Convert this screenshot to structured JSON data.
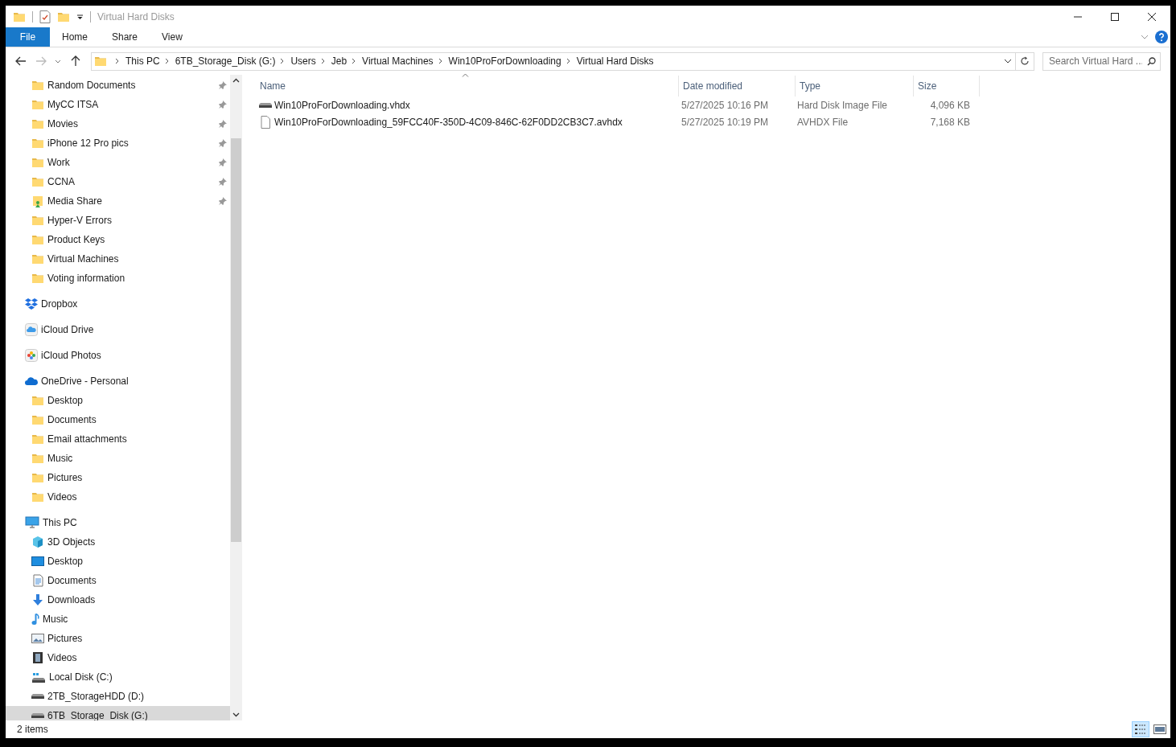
{
  "window": {
    "title": "Virtual Hard Disks"
  },
  "ribbon_tabs": [
    {
      "label": "File",
      "selected": true
    },
    {
      "label": "Home",
      "selected": false
    },
    {
      "label": "Share",
      "selected": false
    },
    {
      "label": "View",
      "selected": false
    }
  ],
  "address_bar": {
    "breadcrumbs": [
      "This PC",
      "6TB_Storage_Disk (G:)",
      "Users",
      "Jeb",
      "Virtual Machines",
      "Win10ProForDownloading",
      "Virtual Hard Disks"
    ]
  },
  "search": {
    "placeholder": "Search Virtual Hard ..."
  },
  "sidebar": {
    "quick_access_items": [
      {
        "label": "Random Documents",
        "kind": "folder",
        "pinned": true,
        "selected": false
      },
      {
        "label": "MyCC ITSA",
        "kind": "folder",
        "pinned": true,
        "selected": false
      },
      {
        "label": "Movies",
        "kind": "folder",
        "pinned": true,
        "selected": false
      },
      {
        "label": "iPhone 12 Pro pics",
        "kind": "folder",
        "pinned": true,
        "selected": false
      },
      {
        "label": "Work",
        "kind": "folder",
        "pinned": true,
        "selected": false
      },
      {
        "label": "CCNA",
        "kind": "folder",
        "pinned": true,
        "selected": false
      },
      {
        "label": "Media Share",
        "kind": "share",
        "pinned": true,
        "selected": false
      },
      {
        "label": "Hyper-V Errors",
        "kind": "folder",
        "pinned": false,
        "selected": false
      },
      {
        "label": "Product Keys",
        "kind": "folder",
        "pinned": false,
        "selected": false
      },
      {
        "label": "Virtual Machines",
        "kind": "folder",
        "pinned": false,
        "selected": false
      },
      {
        "label": "Voting information",
        "kind": "folder",
        "pinned": false,
        "selected": false
      }
    ],
    "roots": [
      {
        "label": "Dropbox",
        "kind": "dropbox",
        "selected": false
      },
      {
        "label": "iCloud Drive",
        "kind": "icloud",
        "selected": false
      },
      {
        "label": "iCloud Photos",
        "kind": "photos",
        "selected": false
      },
      {
        "label": "OneDrive - Personal",
        "kind": "onedrive",
        "selected": false,
        "children": [
          {
            "label": "Desktop",
            "kind": "folder",
            "selected": false
          },
          {
            "label": "Documents",
            "kind": "folder",
            "selected": false
          },
          {
            "label": "Email attachments",
            "kind": "folder",
            "selected": false
          },
          {
            "label": "Music",
            "kind": "folder",
            "selected": false
          },
          {
            "label": "Pictures",
            "kind": "folder",
            "selected": false
          },
          {
            "label": "Videos",
            "kind": "folder",
            "selected": false
          }
        ]
      },
      {
        "label": "This PC",
        "kind": "pc",
        "selected": false,
        "children": [
          {
            "label": "3D Objects",
            "kind": "cube",
            "selected": false
          },
          {
            "label": "Desktop",
            "kind": "desktop",
            "selected": false
          },
          {
            "label": "Documents",
            "kind": "documents",
            "selected": false
          },
          {
            "label": "Downloads",
            "kind": "downloads",
            "selected": false
          },
          {
            "label": "Music",
            "kind": "music",
            "selected": false
          },
          {
            "label": "Pictures",
            "kind": "pictures",
            "selected": false
          },
          {
            "label": "Videos",
            "kind": "videos",
            "selected": false
          },
          {
            "label": "Local Disk (C:)",
            "kind": "windisk",
            "selected": false
          },
          {
            "label": "2TB_StorageHDD (D:)",
            "kind": "disk",
            "selected": false
          },
          {
            "label": "6TB_Storage_Disk (G:)",
            "kind": "disk",
            "selected": true
          }
        ]
      }
    ]
  },
  "file_list": {
    "columns": [
      "Name",
      "Date modified",
      "Type",
      "Size"
    ],
    "rows": [
      {
        "name": "Win10ProForDownloading.vhdx",
        "date_modified": "5/27/2025 10:16 PM",
        "type": "Hard Disk Image File",
        "size": "4,096 KB",
        "kind": "disk"
      },
      {
        "name": "Win10ProForDownloading_59FCC40F-350D-4C09-846C-62F0DD2CB3C7.avhdx",
        "date_modified": "5/27/2025 10:19 PM",
        "type": "AVHDX File",
        "size": "7,168 KB",
        "kind": "file"
      }
    ]
  },
  "status_bar": {
    "item_count": "2 items",
    "views": [
      {
        "kind": "details",
        "selected": true
      },
      {
        "kind": "large-icons",
        "selected": false
      }
    ]
  }
}
